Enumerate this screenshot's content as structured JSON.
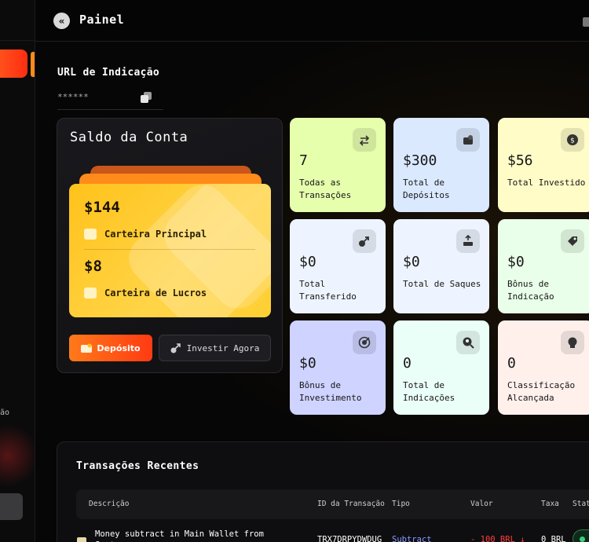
{
  "header": {
    "title": "Painel",
    "back_icon": "«"
  },
  "sidebar": {
    "partial_label": "ão"
  },
  "referral": {
    "label": "URL de Indicação",
    "value": "******"
  },
  "balance": {
    "title": "Saldo da Conta",
    "main_wallet_amount": "$144",
    "main_wallet_label": "Carteira Principal",
    "profit_wallet_amount": "$8",
    "profit_wallet_label": "Carteira de Lucros",
    "deposit_label": "Depósito",
    "invest_label": "Investir Agora"
  },
  "stats": [
    {
      "value": "7",
      "label": "Todas as Transações",
      "icon": "transfer-arrows-icon",
      "bg": "#e6ffad"
    },
    {
      "value": "$300",
      "label": "Total de Depósitos",
      "icon": "wallet-icon",
      "bg": "#dbe9ff"
    },
    {
      "value": "$56",
      "label": "Total Investido",
      "icon": "dollar-coin-icon",
      "bg": "#fffcc8"
    },
    {
      "value": "$0",
      "label": "Total Transferido",
      "icon": "arrow-up-right-icon",
      "bg": "#eef4ff"
    },
    {
      "value": "$0",
      "label": "Total de Saques",
      "icon": "withdraw-icon",
      "bg": "#eef4ff"
    },
    {
      "value": "$0",
      "label": "Bônus de Indicação",
      "icon": "tag-icon",
      "bg": "#e9ffe9"
    },
    {
      "value": "$0",
      "label": "Bônus de Investimento",
      "icon": "target-icon",
      "bg": "#cfd3ff"
    },
    {
      "value": "0",
      "label": "Total de Indicações",
      "icon": "user-search-icon",
      "bg": "#eafff8"
    },
    {
      "value": "0",
      "label": "Classificação Alcançada",
      "icon": "medal-icon",
      "bg": "#fff0ec"
    }
  ],
  "transactions": {
    "title": "Transações Recentes",
    "columns": [
      "Descrição",
      "ID da Transação",
      "Tipo",
      "Valor",
      "Taxa",
      "Stat"
    ],
    "rows": [
      {
        "description": "Money subtract in Main Wallet from System",
        "id": "TRX7DRPYDWDUG",
        "type": "Subtract",
        "amount": "- 100 BRL ↓",
        "fee": "0 BRL"
      }
    ]
  },
  "colors": {
    "accent": "#ff5a1f",
    "wallet": "#ffc21a",
    "negative": "#ff3b3b",
    "type_link": "#8a9bff"
  }
}
